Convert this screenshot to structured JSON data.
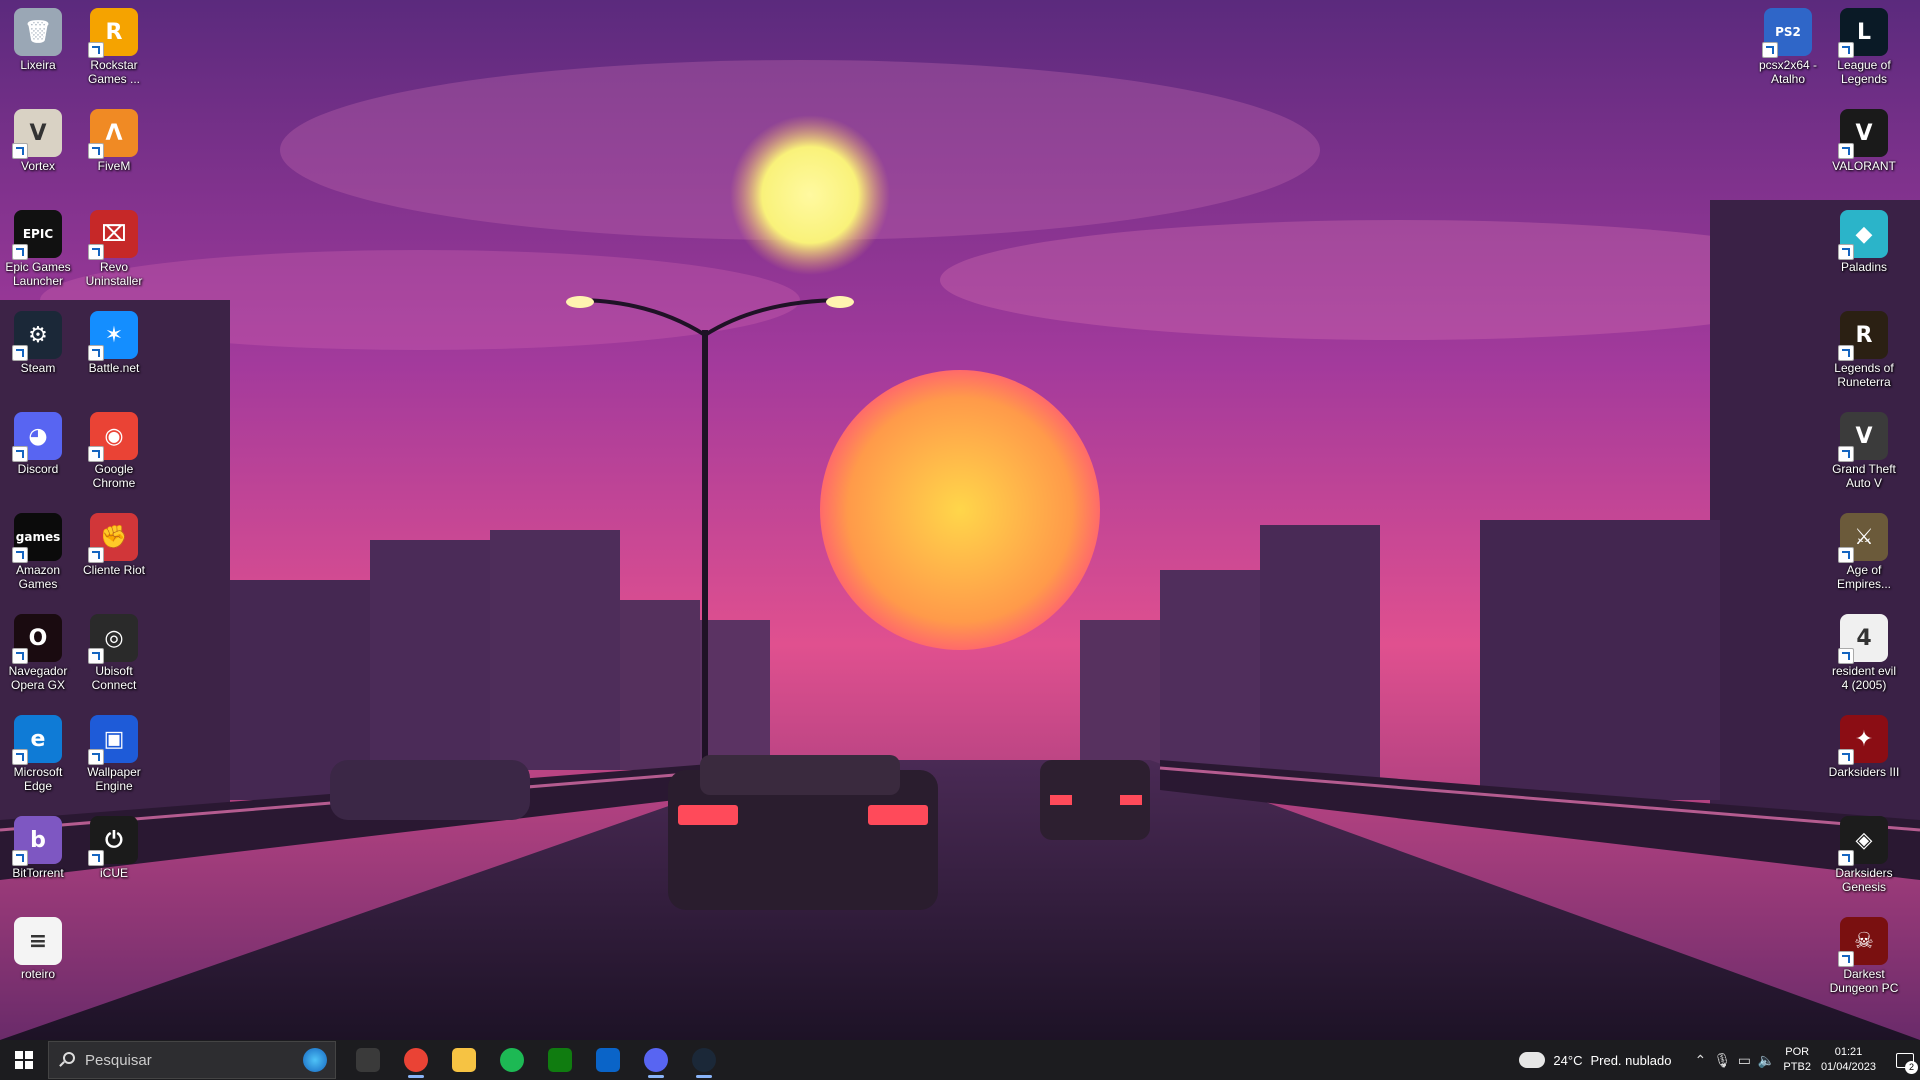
{
  "desktop": {
    "left_icons": [
      {
        "label": "Lixeira",
        "icon": "recycle-bin-icon",
        "color": "#9aa7b5",
        "glyph": "🗑"
      },
      {
        "label": "Rockstar Games ...",
        "icon": "rockstar-icon",
        "color": "#f5a300",
        "glyph": "R"
      },
      {
        "label": "Vortex",
        "icon": "vortex-icon",
        "color": "#d9d2c4",
        "glyph": "V"
      },
      {
        "label": "FiveM",
        "icon": "fivem-icon",
        "color": "#f08a24",
        "glyph": "Λ"
      },
      {
        "label": "Epic Games Launcher",
        "icon": "epic-games-icon",
        "color": "#111111",
        "glyph": "EPIC"
      },
      {
        "label": "Revo Uninstaller",
        "icon": "revo-uninstaller-icon",
        "color": "#c62828",
        "glyph": "⌧"
      },
      {
        "label": "Steam",
        "icon": "steam-icon",
        "color": "#1b2838",
        "glyph": "⚙"
      },
      {
        "label": "Battle.net",
        "icon": "battlenet-icon",
        "color": "#148eff",
        "glyph": "✶"
      },
      {
        "label": "Discord",
        "icon": "discord-icon",
        "color": "#5865f2",
        "glyph": "◕"
      },
      {
        "label": "Google Chrome",
        "icon": "chrome-icon",
        "color": "#ea4335",
        "glyph": "◉"
      },
      {
        "label": "Amazon Games",
        "icon": "amazon-games-icon",
        "color": "#0b0b0b",
        "glyph": "games"
      },
      {
        "label": "Cliente Riot",
        "icon": "riot-client-icon",
        "color": "#d13639",
        "glyph": "✊"
      },
      {
        "label": "Navegador Opera GX",
        "icon": "opera-gx-icon",
        "color": "#1a0b10",
        "glyph": "O"
      },
      {
        "label": "Ubisoft Connect",
        "icon": "ubisoft-icon",
        "color": "#2a2a2a",
        "glyph": "◎"
      },
      {
        "label": "Microsoft Edge",
        "icon": "edge-icon",
        "color": "#0f7bd6",
        "glyph": "e"
      },
      {
        "label": "Wallpaper Engine",
        "icon": "wallpaper-engine-icon",
        "color": "#1e5bd8",
        "glyph": "▣"
      },
      {
        "label": "BitTorrent",
        "icon": "bittorrent-icon",
        "color": "#7e57c2",
        "glyph": "b"
      },
      {
        "label": "iCUE",
        "icon": "icue-icon",
        "color": "#1b1b1b",
        "glyph": "⏻"
      },
      {
        "label": "roteiro",
        "icon": "text-file-icon",
        "color": "#f4f4f4",
        "glyph": "≡"
      }
    ],
    "right_icons": [
      {
        "label": "pcsx2x64 - Atalho",
        "icon": "pcsx2-icon",
        "color": "#2f66c8",
        "glyph": "PS2"
      },
      {
        "label": "League of Legends",
        "icon": "league-of-legends-icon",
        "color": "#0a1a26",
        "glyph": "L"
      },
      {
        "label": "VALORANT",
        "icon": "valorant-icon",
        "color": "#1a1a1a",
        "glyph": "V"
      },
      {
        "label": "Paladins",
        "icon": "paladins-icon",
        "color": "#2bb4c9",
        "glyph": "◆"
      },
      {
        "label": "Legends of Runeterra",
        "icon": "runeterra-icon",
        "color": "#2b2013",
        "glyph": "R"
      },
      {
        "label": "Grand Theft Auto V",
        "icon": "gta-v-icon",
        "color": "#3b3b3b",
        "glyph": "V"
      },
      {
        "label": "Age of Empires...",
        "icon": "age-of-empires-icon",
        "color": "#6b5a3a",
        "glyph": "⚔"
      },
      {
        "label": "resident evil 4 (2005)",
        "icon": "resident-evil-4-icon",
        "color": "#f0f0f0",
        "glyph": "4"
      },
      {
        "label": "Darksiders III",
        "icon": "darksiders-3-icon",
        "color": "#8b0d14",
        "glyph": "✦"
      },
      {
        "label": "Darksiders Genesis",
        "icon": "darksiders-genesis-icon",
        "color": "#1c1c1c",
        "glyph": "◈"
      },
      {
        "label": "Darkest Dungeon PC",
        "icon": "darkest-dungeon-icon",
        "color": "#7a1010",
        "glyph": "☠"
      }
    ]
  },
  "taskbar": {
    "search_placeholder": "Pesquisar",
    "apps": [
      {
        "name": "task-view",
        "icon": "task-view-icon",
        "color": "#3a3a3a"
      },
      {
        "name": "chrome",
        "icon": "chrome-icon",
        "color": "#ea4335",
        "running": true
      },
      {
        "name": "file-explorer",
        "icon": "folder-icon",
        "color": "#f6c343"
      },
      {
        "name": "spotify",
        "icon": "spotify-icon",
        "color": "#1db954"
      },
      {
        "name": "xbox",
        "icon": "xbox-icon",
        "color": "#107c10"
      },
      {
        "name": "mail",
        "icon": "mail-icon",
        "color": "#0a64c8"
      },
      {
        "name": "discord",
        "icon": "discord-icon",
        "color": "#5865f2",
        "running": true
      },
      {
        "name": "steam",
        "icon": "steam-icon",
        "color": "#1b2838",
        "running": true
      }
    ],
    "weather": {
      "temp": "24°C",
      "desc": "Pred. nublado"
    },
    "tray_icons": [
      "chevron-up-icon",
      "microphone-icon",
      "network-icon",
      "volume-icon"
    ],
    "language": {
      "line1": "POR",
      "line2": "PTB2"
    },
    "clock": {
      "time": "01:21",
      "date": "01/04/2023"
    },
    "notifications": {
      "count": "2"
    }
  }
}
